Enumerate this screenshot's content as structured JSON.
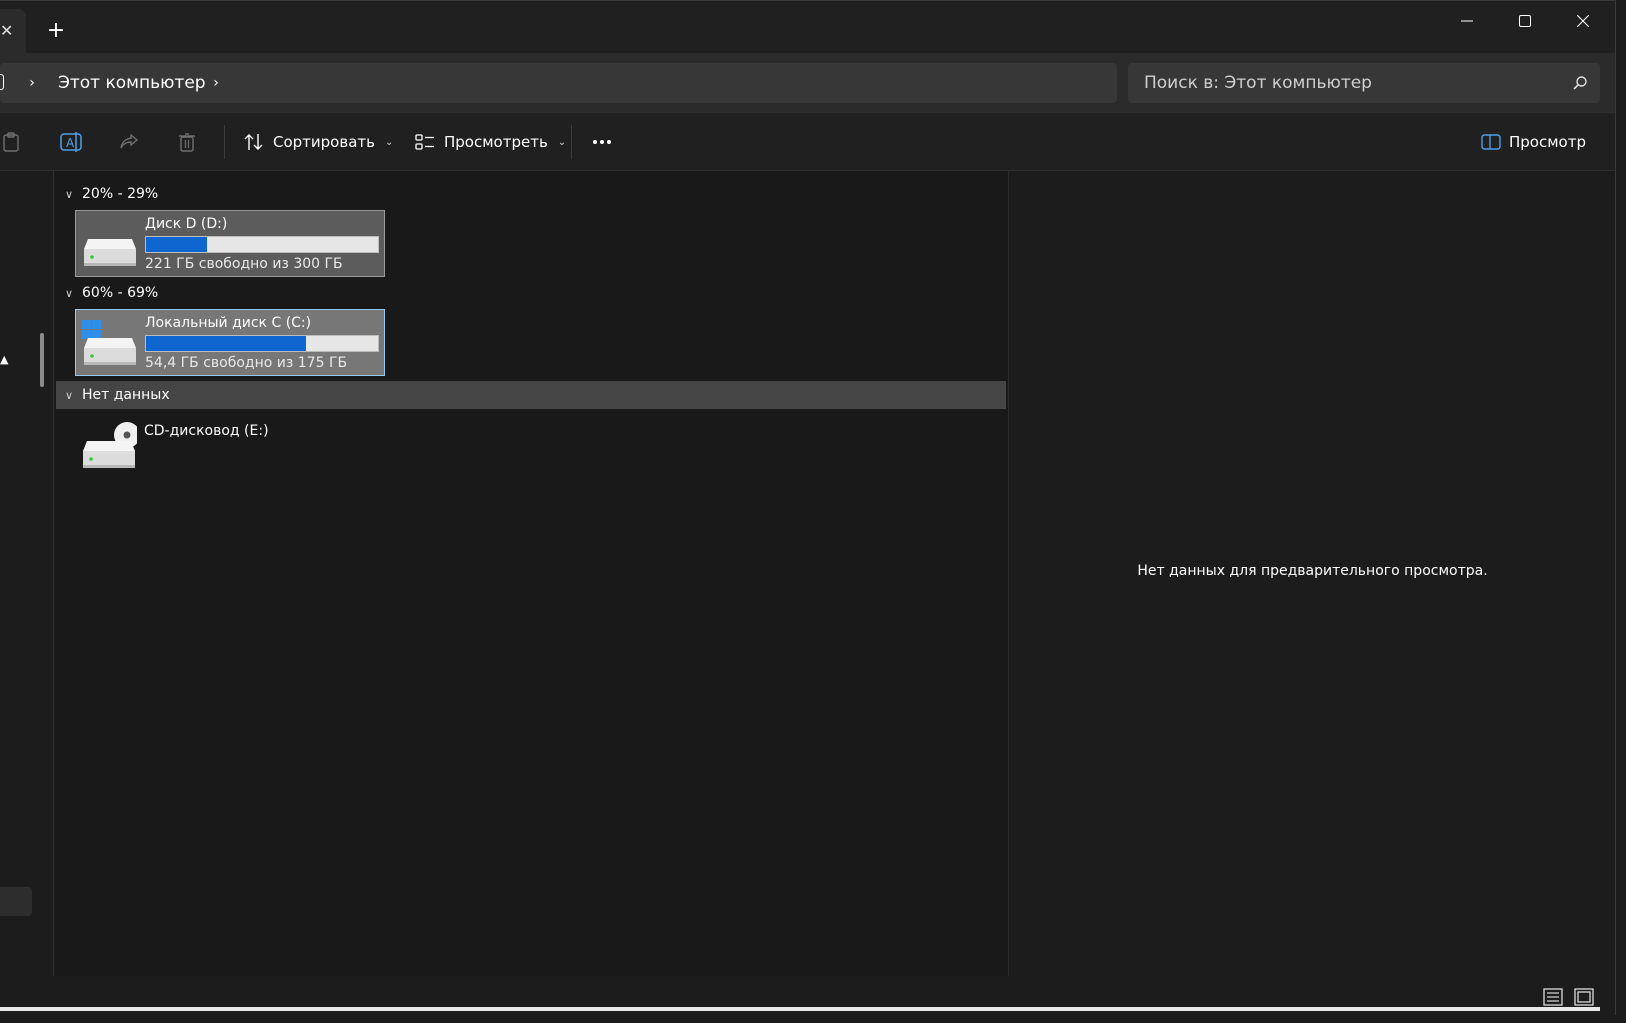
{
  "titlebar": {
    "new_tab_label": "+",
    "tab_close_label": "✕"
  },
  "address": {
    "crumbs": [
      "Этот компьютер"
    ],
    "chevron": "›"
  },
  "search": {
    "placeholder": "Поиск в: Этот компьютер"
  },
  "toolbar": {
    "sort_label": "Сортировать",
    "view_label": "Просмотреть",
    "preview_label": "Просмотр",
    "caret": "⌄"
  },
  "groups": [
    {
      "label": "20% - 29%"
    },
    {
      "label": "60% - 69%"
    },
    {
      "label": "Нет данных"
    }
  ],
  "drives": [
    {
      "name": "Диск D (D:)",
      "free_text": "221 ГБ свободно из 300 ГБ",
      "used_fraction": 0.263
    },
    {
      "name": "Локальный диск C (C:)",
      "free_text": "54,4 ГБ свободно из 175 ГБ",
      "used_fraction": 0.689
    },
    {
      "name": "CD-дисковод (E:)"
    }
  ],
  "preview": {
    "empty_text": "Нет данных для предварительного просмотра."
  },
  "colors": {
    "accent": "#0f66d0",
    "background": "#191919"
  }
}
